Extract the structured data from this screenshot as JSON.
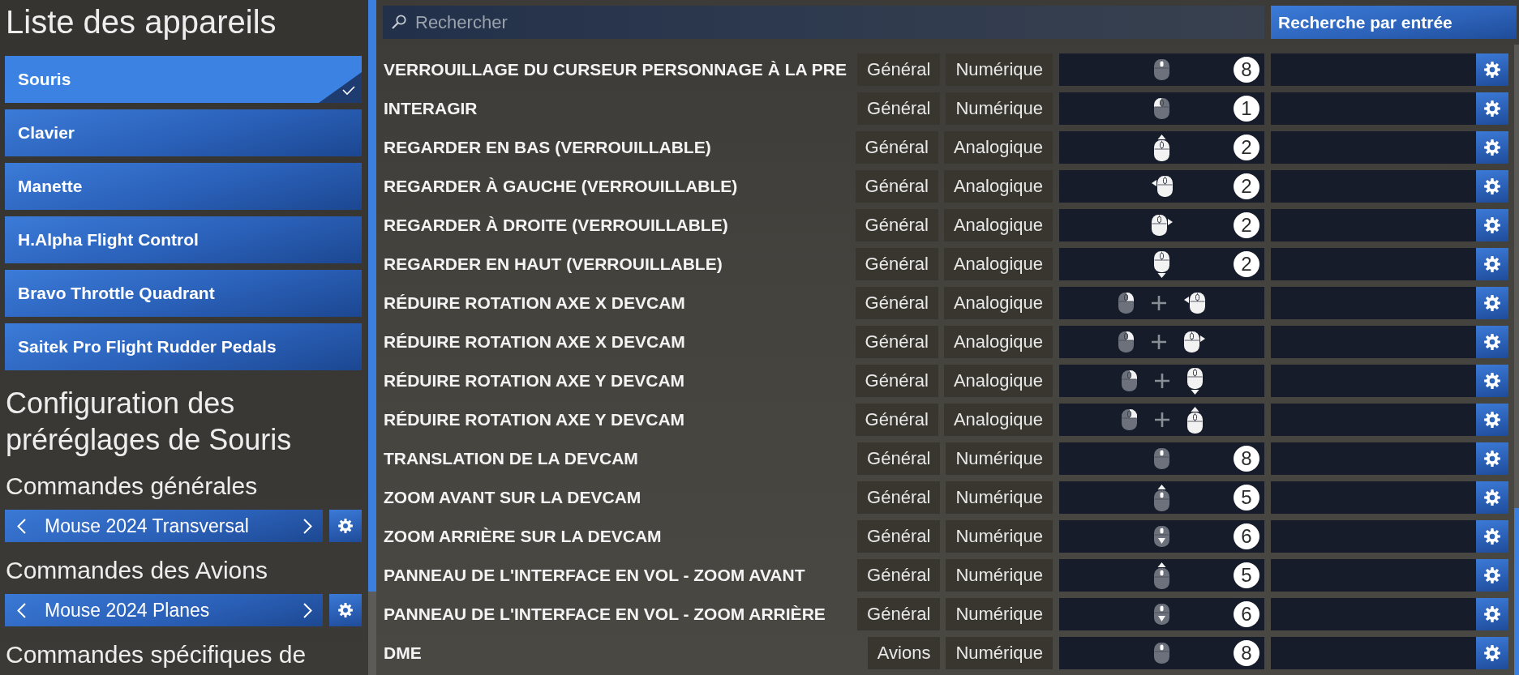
{
  "sidebar": {
    "title": "Liste des appareils",
    "devices": [
      {
        "label": "Souris",
        "selected": true
      },
      {
        "label": "Clavier",
        "selected": false
      },
      {
        "label": "Manette",
        "selected": false
      },
      {
        "label": "H.Alpha Flight Control",
        "selected": false
      },
      {
        "label": "Bravo Throttle Quadrant",
        "selected": false
      },
      {
        "label": "Saitek Pro Flight Rudder Pedals",
        "selected": false
      }
    ],
    "config_heading": "Configuration des préréglages de Souris",
    "sections": [
      {
        "heading": "Commandes générales",
        "preset": "Mouse 2024 Transversal"
      },
      {
        "heading": "Commandes des Avions",
        "preset": "Mouse 2024 Planes"
      },
      {
        "heading": "Commandes spécifiques de"
      }
    ]
  },
  "search": {
    "placeholder": "Rechercher"
  },
  "search_by_input_button": "Recherche par entrée",
  "bindings": [
    {
      "action": "VERROUILLAGE DU CURSEUR PERSONNAGE À LA PRE",
      "category": "Général",
      "input_type": "Numérique",
      "inputs": [
        {
          "kind": "wheel"
        }
      ],
      "number": "8"
    },
    {
      "action": "INTERAGIR",
      "category": "Général",
      "input_type": "Numérique",
      "inputs": [
        {
          "kind": "leftbutton"
        }
      ],
      "number": "1"
    },
    {
      "action": "REGARDER EN BAS (VERROUILLABLE)",
      "category": "Général",
      "input_type": "Analogique",
      "inputs": [
        {
          "kind": "moveup"
        }
      ],
      "number": "2"
    },
    {
      "action": "REGARDER À GAUCHE (VERROUILLABLE)",
      "category": "Général",
      "input_type": "Analogique",
      "inputs": [
        {
          "kind": "moveleft"
        }
      ],
      "number": "2"
    },
    {
      "action": "REGARDER À DROITE (VERROUILLABLE)",
      "category": "Général",
      "input_type": "Analogique",
      "inputs": [
        {
          "kind": "moveright"
        }
      ],
      "number": "2"
    },
    {
      "action": "REGARDER EN HAUT (VERROUILLABLE)",
      "category": "Général",
      "input_type": "Analogique",
      "inputs": [
        {
          "kind": "movedown"
        }
      ],
      "number": "2"
    },
    {
      "action": "RÉDUIRE ROTATION AXE X DEVCAM",
      "category": "Général",
      "input_type": "Analogique",
      "inputs": [
        {
          "kind": "rightbutton"
        },
        {
          "kind": "moveleft"
        }
      ]
    },
    {
      "action": "RÉDUIRE ROTATION AXE X DEVCAM",
      "category": "Général",
      "input_type": "Analogique",
      "inputs": [
        {
          "kind": "rightbutton"
        },
        {
          "kind": "moveright"
        }
      ]
    },
    {
      "action": "RÉDUIRE ROTATION AXE Y DEVCAM",
      "category": "Général",
      "input_type": "Analogique",
      "inputs": [
        {
          "kind": "rightbutton"
        },
        {
          "kind": "movedown"
        }
      ]
    },
    {
      "action": "RÉDUIRE ROTATION AXE Y DEVCAM",
      "category": "Général",
      "input_type": "Analogique",
      "inputs": [
        {
          "kind": "rightbutton"
        },
        {
          "kind": "moveup"
        }
      ]
    },
    {
      "action": "TRANSLATION DE LA DEVCAM",
      "category": "Général",
      "input_type": "Numérique",
      "inputs": [
        {
          "kind": "wheel"
        }
      ],
      "number": "8"
    },
    {
      "action": "ZOOM AVANT SUR LA DEVCAM",
      "category": "Général",
      "input_type": "Numérique",
      "inputs": [
        {
          "kind": "scrollup"
        }
      ],
      "number": "5"
    },
    {
      "action": "ZOOM ARRIÈRE SUR LA DEVCAM",
      "category": "Général",
      "input_type": "Numérique",
      "inputs": [
        {
          "kind": "scrolldown"
        }
      ],
      "number": "6"
    },
    {
      "action": "PANNEAU DE L'INTERFACE EN VOL - ZOOM AVANT",
      "category": "Général",
      "input_type": "Numérique",
      "inputs": [
        {
          "kind": "scrollup"
        }
      ],
      "number": "5"
    },
    {
      "action": "PANNEAU DE L'INTERFACE EN VOL - ZOOM ARRIÈRE",
      "category": "Général",
      "input_type": "Numérique",
      "inputs": [
        {
          "kind": "scrolldown"
        }
      ],
      "number": "6"
    },
    {
      "action": "DME",
      "category": "Avions",
      "input_type": "Numérique",
      "inputs": [
        {
          "kind": "wheel"
        }
      ],
      "number": "8"
    }
  ]
}
